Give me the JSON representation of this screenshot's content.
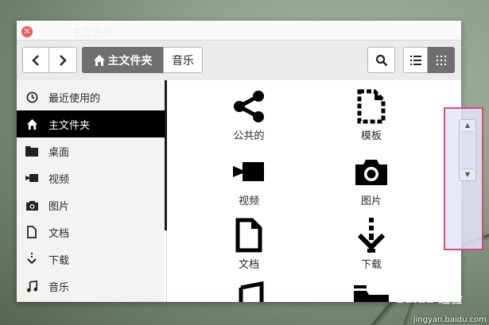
{
  "window": {
    "title": "主文件夹"
  },
  "toolbar": {
    "path_home_label": "主文件夹",
    "path_music_label": "音乐"
  },
  "sidebar": {
    "items": [
      {
        "label": "最近使用的",
        "icon": "clock-icon"
      },
      {
        "label": "主文件夹",
        "icon": "home-icon",
        "active": true
      },
      {
        "label": "桌面",
        "icon": "folder-icon"
      },
      {
        "label": "视频",
        "icon": "video-camera-icon"
      },
      {
        "label": "图片",
        "icon": "camera-icon"
      },
      {
        "label": "文档",
        "icon": "document-icon"
      },
      {
        "label": "下载",
        "icon": "download-icon"
      },
      {
        "label": "音乐",
        "icon": "music-icon"
      }
    ]
  },
  "content": {
    "items": [
      {
        "label": "公共的",
        "icon": "share-icon"
      },
      {
        "label": "模板",
        "icon": "template-icon"
      },
      {
        "label": "视频",
        "icon": "video-camera-icon"
      },
      {
        "label": "图片",
        "icon": "camera-icon"
      },
      {
        "label": "文档",
        "icon": "document-icon"
      },
      {
        "label": "下载",
        "icon": "download-icon"
      },
      {
        "label": "",
        "icon": "music-icon"
      },
      {
        "label": "",
        "icon": "folder-icon"
      }
    ]
  },
  "watermark": {
    "text": "jingyan.baidu.com",
    "logo": "Baidu 经验"
  },
  "colors": {
    "active_bg": "#000000",
    "path_active_bg": "#6f6f6f",
    "highlight_border": "#e0457a",
    "close_button": "#f25a5a"
  }
}
